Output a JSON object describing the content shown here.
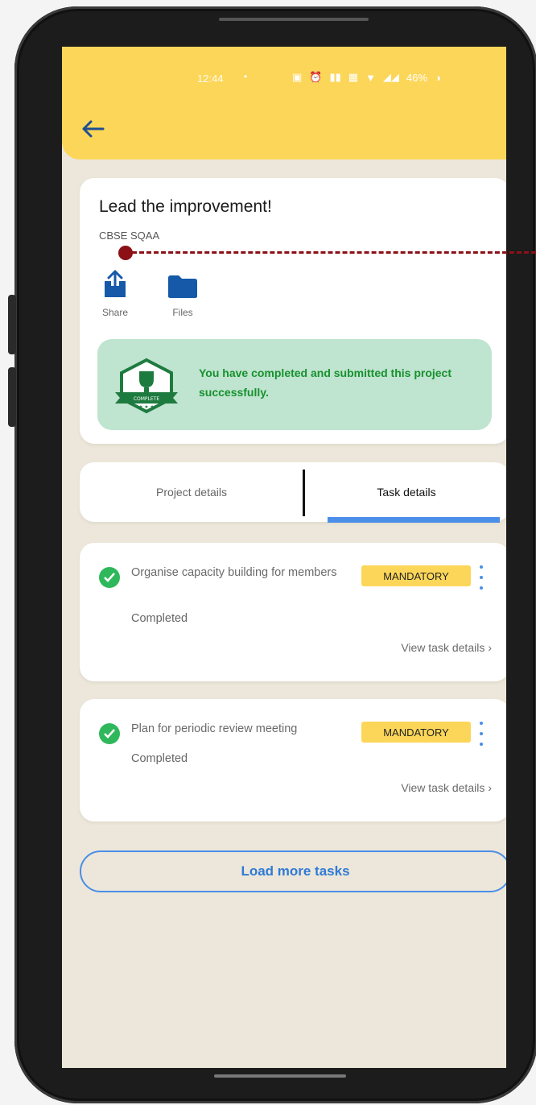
{
  "status_bar": {
    "time": "12:44",
    "battery": "46%"
  },
  "header": {
    "back_icon": "arrow-left-icon"
  },
  "project": {
    "title": "Lead the improvement!",
    "subtitle": "CBSE SQAA",
    "actions": [
      {
        "label": "Share",
        "icon": "share-upload-icon"
      },
      {
        "label": "Files",
        "icon": "folder-icon"
      }
    ],
    "completion_message": "You have completed and submitted this project successfully.",
    "badge_text": "COMPLETE"
  },
  "tabs": [
    {
      "label": "Project details",
      "active": false
    },
    {
      "label": "Task details",
      "active": true
    }
  ],
  "tasks": [
    {
      "title": "Organise capacity building for members",
      "status": "Completed",
      "tag": "MANDATORY",
      "link": "View task details"
    },
    {
      "title": "Plan for periodic review meeting",
      "status": "Completed",
      "tag": "MANDATORY",
      "link": "View task details"
    }
  ],
  "load_more_label": "Load more tasks",
  "colors": {
    "header": "#fcd659",
    "background": "#ece7da",
    "success_bg": "#bfe4cf",
    "success_text": "#17912f",
    "accent": "#4a8ee8",
    "annotation": "#8b1116"
  }
}
